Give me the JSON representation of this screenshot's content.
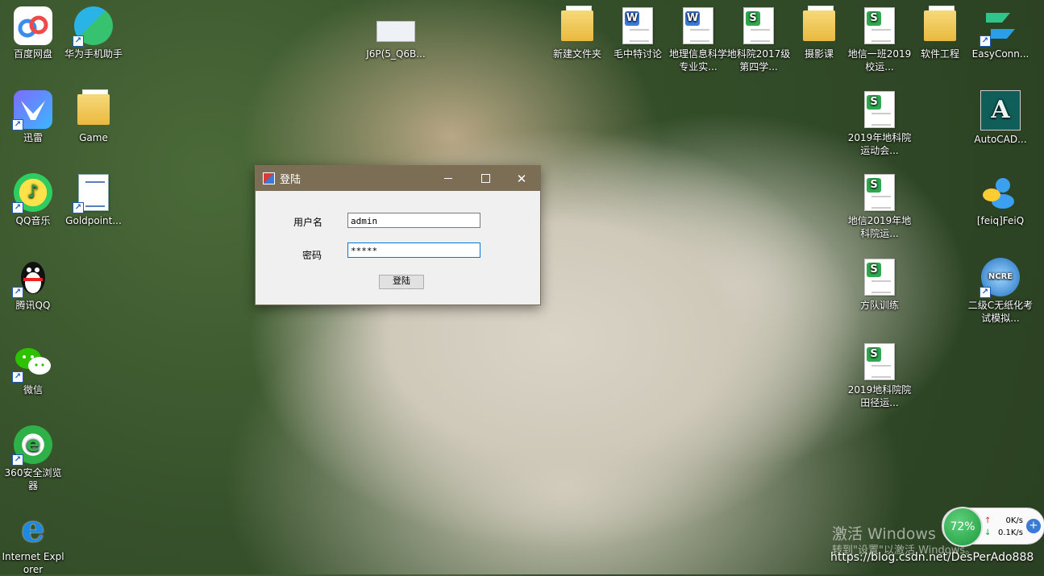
{
  "desktop": {
    "icons": [
      {
        "id": "baidu",
        "label": "百度网盘"
      },
      {
        "id": "huawei",
        "label": "华为手机助手"
      },
      {
        "id": "j6p",
        "label": "J6P(5_Q6B..."
      },
      {
        "id": "newfolder",
        "label": "新建文件夹"
      },
      {
        "id": "mao",
        "label": "毛中特讨论"
      },
      {
        "id": "dili",
        "label": "地理信息科学专业实..."
      },
      {
        "id": "dike2017",
        "label": "地科院2017级第四学..."
      },
      {
        "id": "sheying",
        "label": "摄影课"
      },
      {
        "id": "dixin",
        "label": "地信一班2019校运..."
      },
      {
        "id": "ruanjian",
        "label": "软件工程"
      },
      {
        "id": "easyconn",
        "label": "EasyConn..."
      },
      {
        "id": "xunlei",
        "label": "迅雷"
      },
      {
        "id": "game",
        "label": "Game"
      },
      {
        "id": "dike2019",
        "label": "2019年地科院运动会..."
      },
      {
        "id": "autocad",
        "label": "AutoCAD..."
      },
      {
        "id": "qqmusic",
        "label": "QQ音乐"
      },
      {
        "id": "goldpoint",
        "label": "Goldpoint..."
      },
      {
        "id": "dixin2019",
        "label": "地信2019年地科院运..."
      },
      {
        "id": "feiq",
        "label": "[feiq]FeiQ"
      },
      {
        "id": "qq",
        "label": "腾讯QQ"
      },
      {
        "id": "fangdui",
        "label": "方队训练"
      },
      {
        "id": "erjic",
        "label": "二级C无纸化考试模拟..."
      },
      {
        "id": "weixin",
        "label": "微信"
      },
      {
        "id": "tianjing",
        "label": "2019地科院院田径运..."
      },
      {
        "id": "browser360",
        "label": "360安全浏览器"
      },
      {
        "id": "ie",
        "label": "Internet Explorer"
      }
    ]
  },
  "dialog": {
    "title": "登陆",
    "username_label": "用户名",
    "username_value": "admin",
    "password_label": "密码",
    "password_value": "*****",
    "login_button": "登陆",
    "min_glyph": "—",
    "close_glyph": "✕"
  },
  "network": {
    "percent": "72%",
    "up": "0K/s",
    "down": "0.1K/s",
    "up_arrow": "↑",
    "down_arrow": "↓",
    "plus": "+"
  },
  "watermark": {
    "line1": "激活 Windows",
    "line2": "转到\"设置\"以激活 Windows。",
    "csdn": "https://blog.csdn.net/DesPerAdo888"
  },
  "colors": {
    "titlebar": "#7c6d55",
    "focus_border": "#0078d7"
  }
}
